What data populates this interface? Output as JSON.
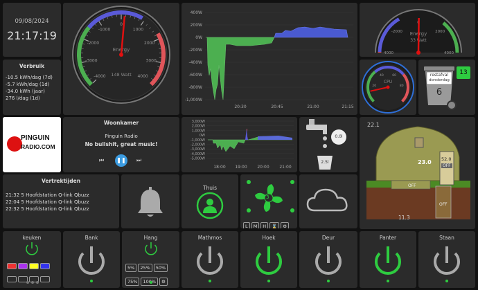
{
  "clock": {
    "date": "09/08/2024",
    "time": "21:17:19"
  },
  "verbruik": {
    "title": "Verbruik",
    "lines": [
      "-10.5 kWh/dag (7d)",
      "-5.7 kWh/dag (1d)",
      "-34.0 kWh (jaar)",
      "276 l/dag (1d)"
    ]
  },
  "gauge_main": {
    "label": "Energy",
    "value_text": "148 Watt",
    "ticks": [
      "-4000",
      "-3000",
      "-2000",
      "-1000",
      "0",
      "1000",
      "2000",
      "3000",
      "4000"
    ],
    "value": 148,
    "min": -4000,
    "max": 4000
  },
  "power_chart": {
    "y_ticks": [
      "400W",
      "200W",
      "0W",
      "-200W",
      "-400W",
      "-600W",
      "-800W",
      "-1,000W"
    ],
    "x_ticks": [
      "20:30",
      "20:45",
      "21:00",
      "21:15"
    ]
  },
  "gauge_right": {
    "label": "Energy",
    "value_text": "33 Watt",
    "ticks": [
      "-4000",
      "-2000",
      "0",
      "2000",
      "4000"
    ],
    "value": 33,
    "min": -4000,
    "max": 4000
  },
  "gauge_cpu": {
    "label": "CPU",
    "ticks": [
      "20",
      "40",
      "60",
      "80"
    ],
    "value": 12
  },
  "waste": {
    "type": "restafval",
    "day": "donderdag",
    "days": "6",
    "badge": "13"
  },
  "radio": {
    "logo_top": "PINGUIN",
    "logo_bottom": "RADIO.COM",
    "room": "Woonkamer",
    "station": "Pinguin Radio",
    "song": "No bullshit, great music!"
  },
  "day_chart": {
    "y_ticks": [
      "3,000W",
      "2,000W",
      "1,000W",
      "0W",
      "-1,000W",
      "-2,000W",
      "-3,000W",
      "-4,000W",
      "-5,000W"
    ],
    "x_ticks": [
      "18:00",
      "19:00",
      "20:00",
      "21:00"
    ]
  },
  "water": {
    "tap_value": "0.0l",
    "bucket_value": "2.5l"
  },
  "house": {
    "temp_outside": "22.1",
    "temp_inside": "23.0",
    "humidity": "52.0",
    "soil": "11.3",
    "off1": "OFF",
    "off2": "OFF",
    "off3": "OFF"
  },
  "departures": {
    "title": "Vertrektijden",
    "rows": [
      "21:32 5 Hoofdstation Q-link Qbuzz",
      "22:04 5 Hoofdstation Q-link Qbuzz",
      "22:32 5 Hoofdstation Q-link Qbuzz"
    ]
  },
  "thuis": {
    "label": "Thuis"
  },
  "fan": {
    "speed": "3",
    "buttons": [
      "L",
      "M",
      "H"
    ]
  },
  "switches": [
    {
      "label": "keuken"
    },
    {
      "label": "Bank"
    },
    {
      "label": "Hang",
      "presets": [
        "5%",
        "25%",
        "50%",
        "75%",
        "100%"
      ]
    },
    {
      "label": "Mathmos"
    },
    {
      "label": "Hoek"
    },
    {
      "label": "Deur"
    },
    {
      "label": "Panter"
    },
    {
      "label": "Staan"
    }
  ],
  "colors": {
    "accent": "#2ecc40",
    "tile": "#2b2b2b",
    "red": "#e0555a",
    "blue": "#5a5ad8",
    "green": "#4caf50"
  }
}
